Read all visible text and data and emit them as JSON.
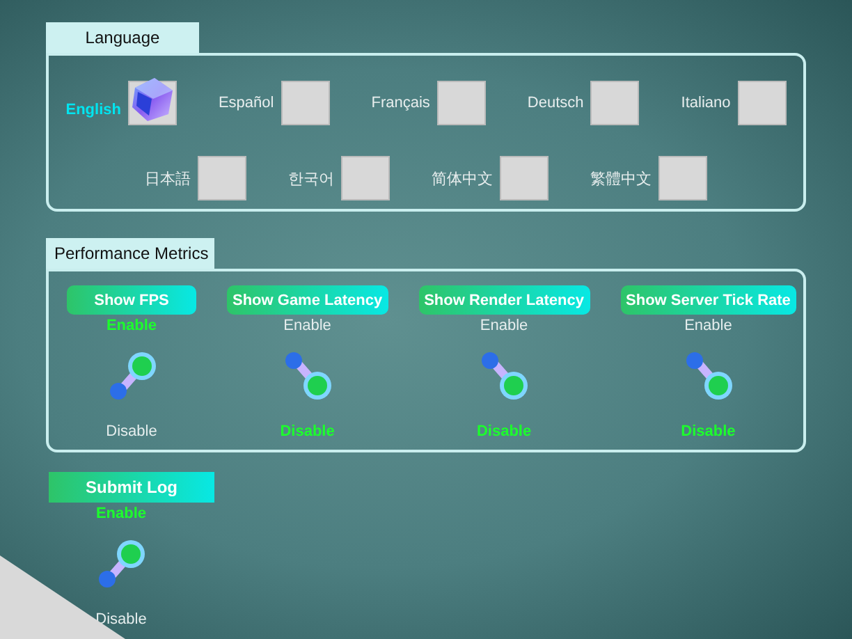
{
  "language": {
    "title": "Language",
    "options": [
      {
        "label": "English",
        "selected": true
      },
      {
        "label": "Español",
        "selected": false
      },
      {
        "label": "Français",
        "selected": false
      },
      {
        "label": "Deutsch",
        "selected": false
      },
      {
        "label": "Italiano",
        "selected": false
      },
      {
        "label": "日本語",
        "selected": false
      },
      {
        "label": "한국어",
        "selected": false
      },
      {
        "label": "简体中文",
        "selected": false
      },
      {
        "label": "繁體中文",
        "selected": false
      }
    ]
  },
  "performance_metrics": {
    "title": "Performance Metrics",
    "items": [
      {
        "label": "Show FPS",
        "on": true,
        "enable_label": "Enable",
        "disable_label": "Disable"
      },
      {
        "label": "Show Game Latency",
        "on": false,
        "enable_label": "Enable",
        "disable_label": "Disable"
      },
      {
        "label": "Show Render Latency",
        "on": false,
        "enable_label": "Enable",
        "disable_label": "Disable"
      },
      {
        "label": "Show Server Tick Rate",
        "on": false,
        "enable_label": "Enable",
        "disable_label": "Disable"
      }
    ]
  },
  "submit_log": {
    "label": "Submit Log",
    "on": true,
    "enable_label": "Enable",
    "disable_label": "Disable"
  }
}
